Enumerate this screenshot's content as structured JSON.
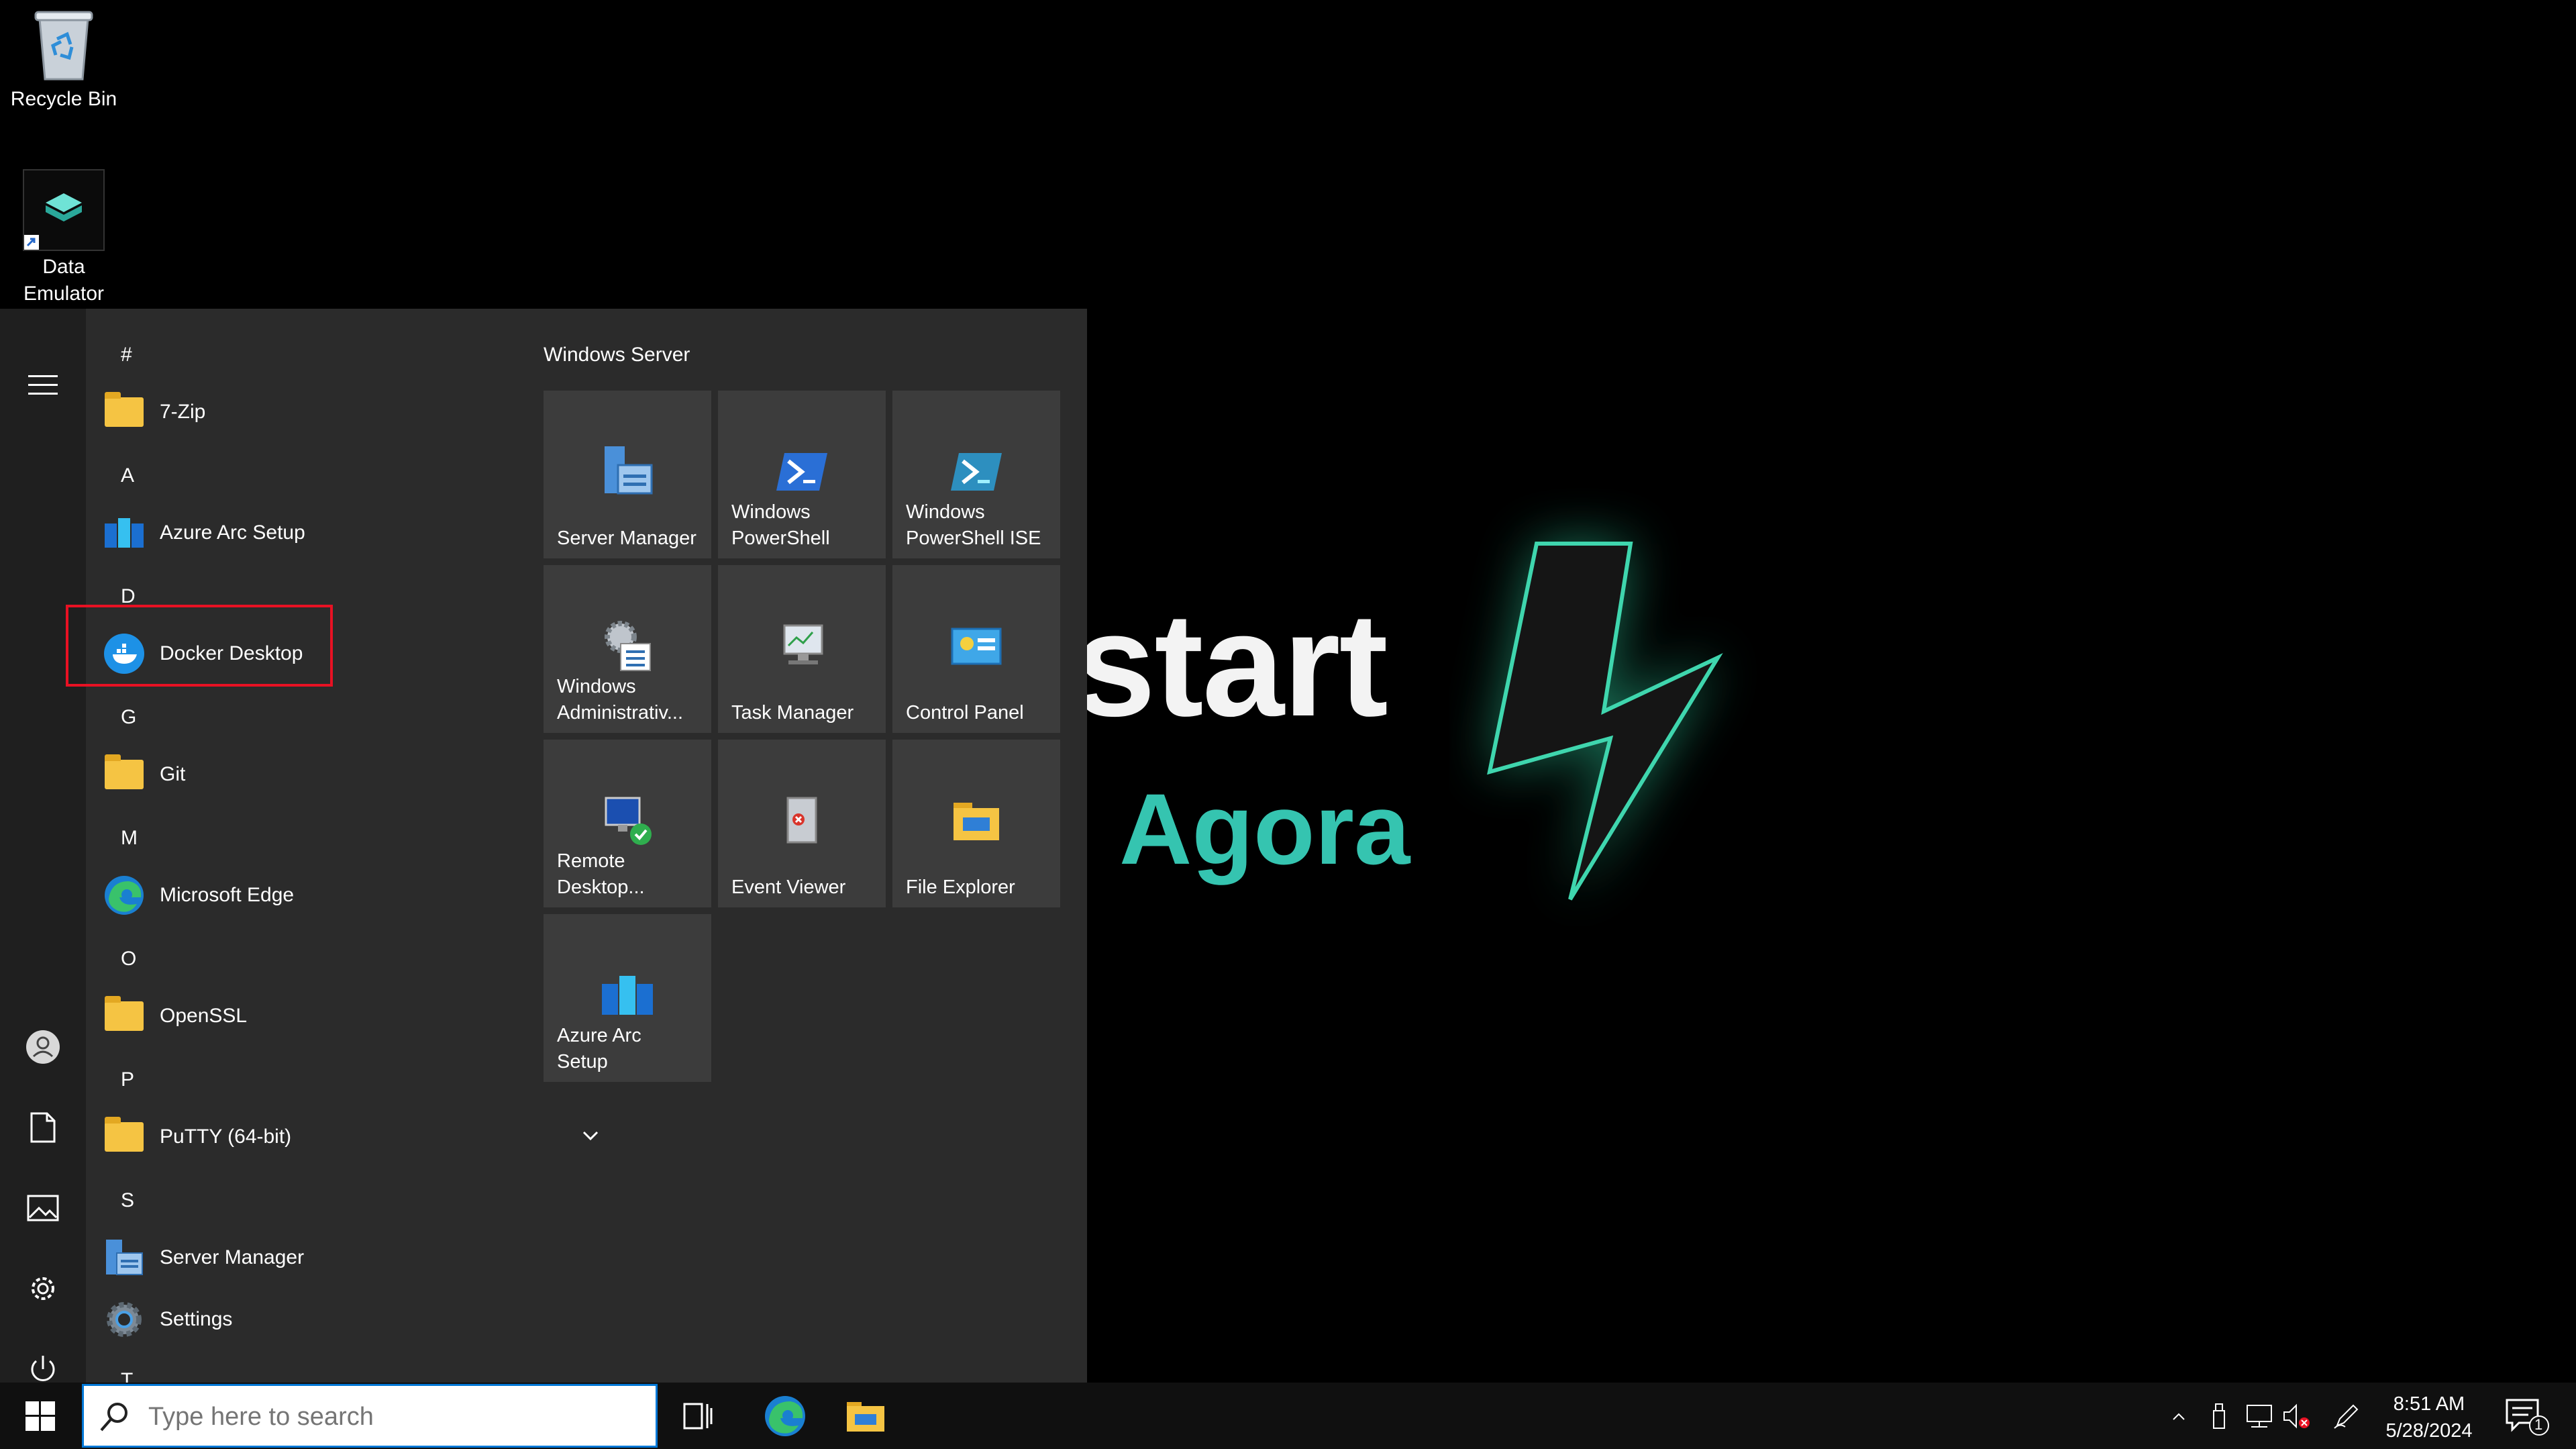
{
  "desktop": {
    "icons": [
      {
        "label": "Recycle Bin"
      },
      {
        "label": "Data\nEmulator"
      }
    ]
  },
  "wallpaper": {
    "line1": "start",
    "line2": "Agora",
    "accent_color": "#35c4b0"
  },
  "start_menu": {
    "sections": [
      {
        "letter": "#",
        "apps": [
          {
            "label": "7-Zip",
            "icon": "folder-icon",
            "expandable": true
          }
        ]
      },
      {
        "letter": "A",
        "apps": [
          {
            "label": "Azure Arc Setup",
            "icon": "azure-arc-icon",
            "expandable": false
          }
        ]
      },
      {
        "letter": "D",
        "apps": [
          {
            "label": "Docker Desktop",
            "icon": "docker-icon",
            "expandable": false,
            "highlighted": true
          }
        ]
      },
      {
        "letter": "G",
        "apps": [
          {
            "label": "Git",
            "icon": "folder-icon",
            "expandable": true
          }
        ]
      },
      {
        "letter": "M",
        "apps": [
          {
            "label": "Microsoft Edge",
            "icon": "edge-icon",
            "expandable": false
          }
        ]
      },
      {
        "letter": "O",
        "apps": [
          {
            "label": "OpenSSL",
            "icon": "folder-icon",
            "expandable": true
          }
        ]
      },
      {
        "letter": "P",
        "apps": [
          {
            "label": "PuTTY (64-bit)",
            "icon": "folder-icon",
            "expandable": true
          }
        ]
      },
      {
        "letter": "S",
        "apps": [
          {
            "label": "Server Manager",
            "icon": "server-manager-icon",
            "expandable": false
          },
          {
            "label": "Settings",
            "icon": "settings-gear-icon",
            "expandable": false
          }
        ]
      },
      {
        "letter": "T",
        "apps": []
      }
    ],
    "tiles_group_title": "Windows Server",
    "tiles": [
      {
        "label": "Server Manager",
        "icon": "server-manager-icon"
      },
      {
        "label": "Windows\nPowerShell",
        "icon": "powershell-icon"
      },
      {
        "label": "Windows\nPowerShell ISE",
        "icon": "powershell-ise-icon"
      },
      {
        "label": "Windows\nAdministrativ...",
        "icon": "admin-tools-icon"
      },
      {
        "label": "Task Manager",
        "icon": "task-manager-icon"
      },
      {
        "label": "Control Panel",
        "icon": "control-panel-icon"
      },
      {
        "label": "Remote\nDesktop...",
        "icon": "remote-desktop-icon"
      },
      {
        "label": "Event Viewer",
        "icon": "event-viewer-icon"
      },
      {
        "label": "File Explorer",
        "icon": "file-explorer-icon"
      },
      {
        "label": "Azure Arc\nSetup",
        "icon": "azure-arc-icon"
      }
    ],
    "rail": [
      "hamburger-menu-icon",
      "user-account-icon",
      "documents-icon",
      "pictures-icon",
      "settings-gear-icon",
      "power-icon"
    ]
  },
  "taskbar": {
    "search_placeholder": "Type here to search",
    "clock_time": "8:51 AM",
    "clock_date": "5/28/2024",
    "notification_count": "1"
  }
}
